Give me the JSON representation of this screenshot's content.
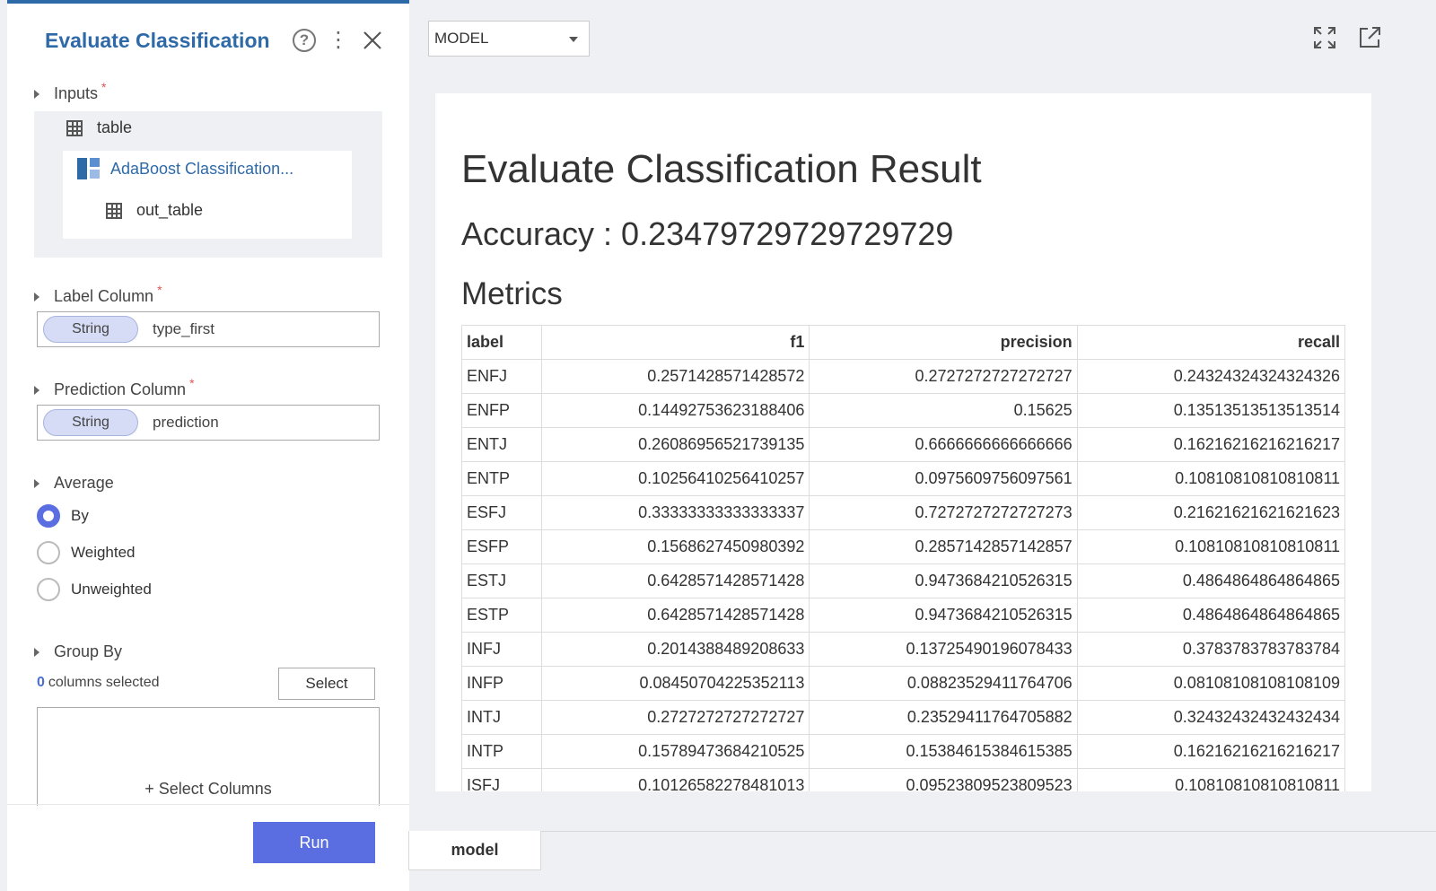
{
  "panel": {
    "title": "Evaluate Classification",
    "help_glyph": "?",
    "menu_glyph": "⋮",
    "close_glyph": "✕"
  },
  "inputs": {
    "label": "Inputs",
    "required_mark": "*",
    "table_label": "table",
    "model_label": "AdaBoost Classification...",
    "out_table_label": "out_table"
  },
  "label_column": {
    "label": "Label Column",
    "required_mark": "*",
    "type": "String",
    "value": "type_first"
  },
  "prediction_column": {
    "label": "Prediction Column",
    "required_mark": "*",
    "type": "String",
    "value": "prediction"
  },
  "average": {
    "label": "Average",
    "options": [
      "By",
      "Weighted",
      "Unweighted"
    ],
    "selected": "By"
  },
  "group_by": {
    "label": "Group By",
    "count": "0",
    "count_suffix": "columns selected",
    "select_button": "Select",
    "add_columns": "+ Select Columns"
  },
  "run_button": "Run",
  "view_select": {
    "value": "MODEL"
  },
  "toolbar": {
    "expand_icon": "expand-icon",
    "popout_icon": "open-external-icon"
  },
  "result": {
    "title": "Evaluate Classification Result",
    "accuracy_text": "Accuracy : 0.23479729729729729",
    "metrics_heading": "Metrics",
    "columns": [
      "label",
      "f1",
      "precision",
      "recall"
    ],
    "rows": [
      [
        "ENFJ",
        "0.2571428571428572",
        "0.2727272727272727",
        "0.24324324324324326"
      ],
      [
        "ENFP",
        "0.14492753623188406",
        "0.15625",
        "0.13513513513513514"
      ],
      [
        "ENTJ",
        "0.26086956521739135",
        "0.6666666666666666",
        "0.16216216216216217"
      ],
      [
        "ENTP",
        "0.10256410256410257",
        "0.0975609756097561",
        "0.10810810810810811"
      ],
      [
        "ESFJ",
        "0.33333333333333337",
        "0.7272727272727273",
        "0.21621621621621623"
      ],
      [
        "ESFP",
        "0.1568627450980392",
        "0.2857142857142857",
        "0.10810810810810811"
      ],
      [
        "ESTJ",
        "0.6428571428571428",
        "0.9473684210526315",
        "0.4864864864864865"
      ],
      [
        "ESTP",
        "0.6428571428571428",
        "0.9473684210526315",
        "0.4864864864864865"
      ],
      [
        "INFJ",
        "0.2014388489208633",
        "0.13725490196078433",
        "0.3783783783783784"
      ],
      [
        "INFP",
        "0.08450704225352113",
        "0.08823529411764706",
        "0.08108108108108109"
      ],
      [
        "INTJ",
        "0.2727272727272727",
        "0.23529411764705882",
        "0.32432432432432434"
      ],
      [
        "INTP",
        "0.15789473684210525",
        "0.15384615384615385",
        "0.16216216216216217"
      ],
      [
        "ISFJ",
        "0.10126582278481013",
        "0.09523809523809523",
        "0.10810810810810811"
      ]
    ]
  },
  "bottom_tabs": [
    "model"
  ],
  "colors": {
    "accent": "#2f6aa8",
    "primary_button": "#5b6ee1",
    "required": "#e05555"
  }
}
